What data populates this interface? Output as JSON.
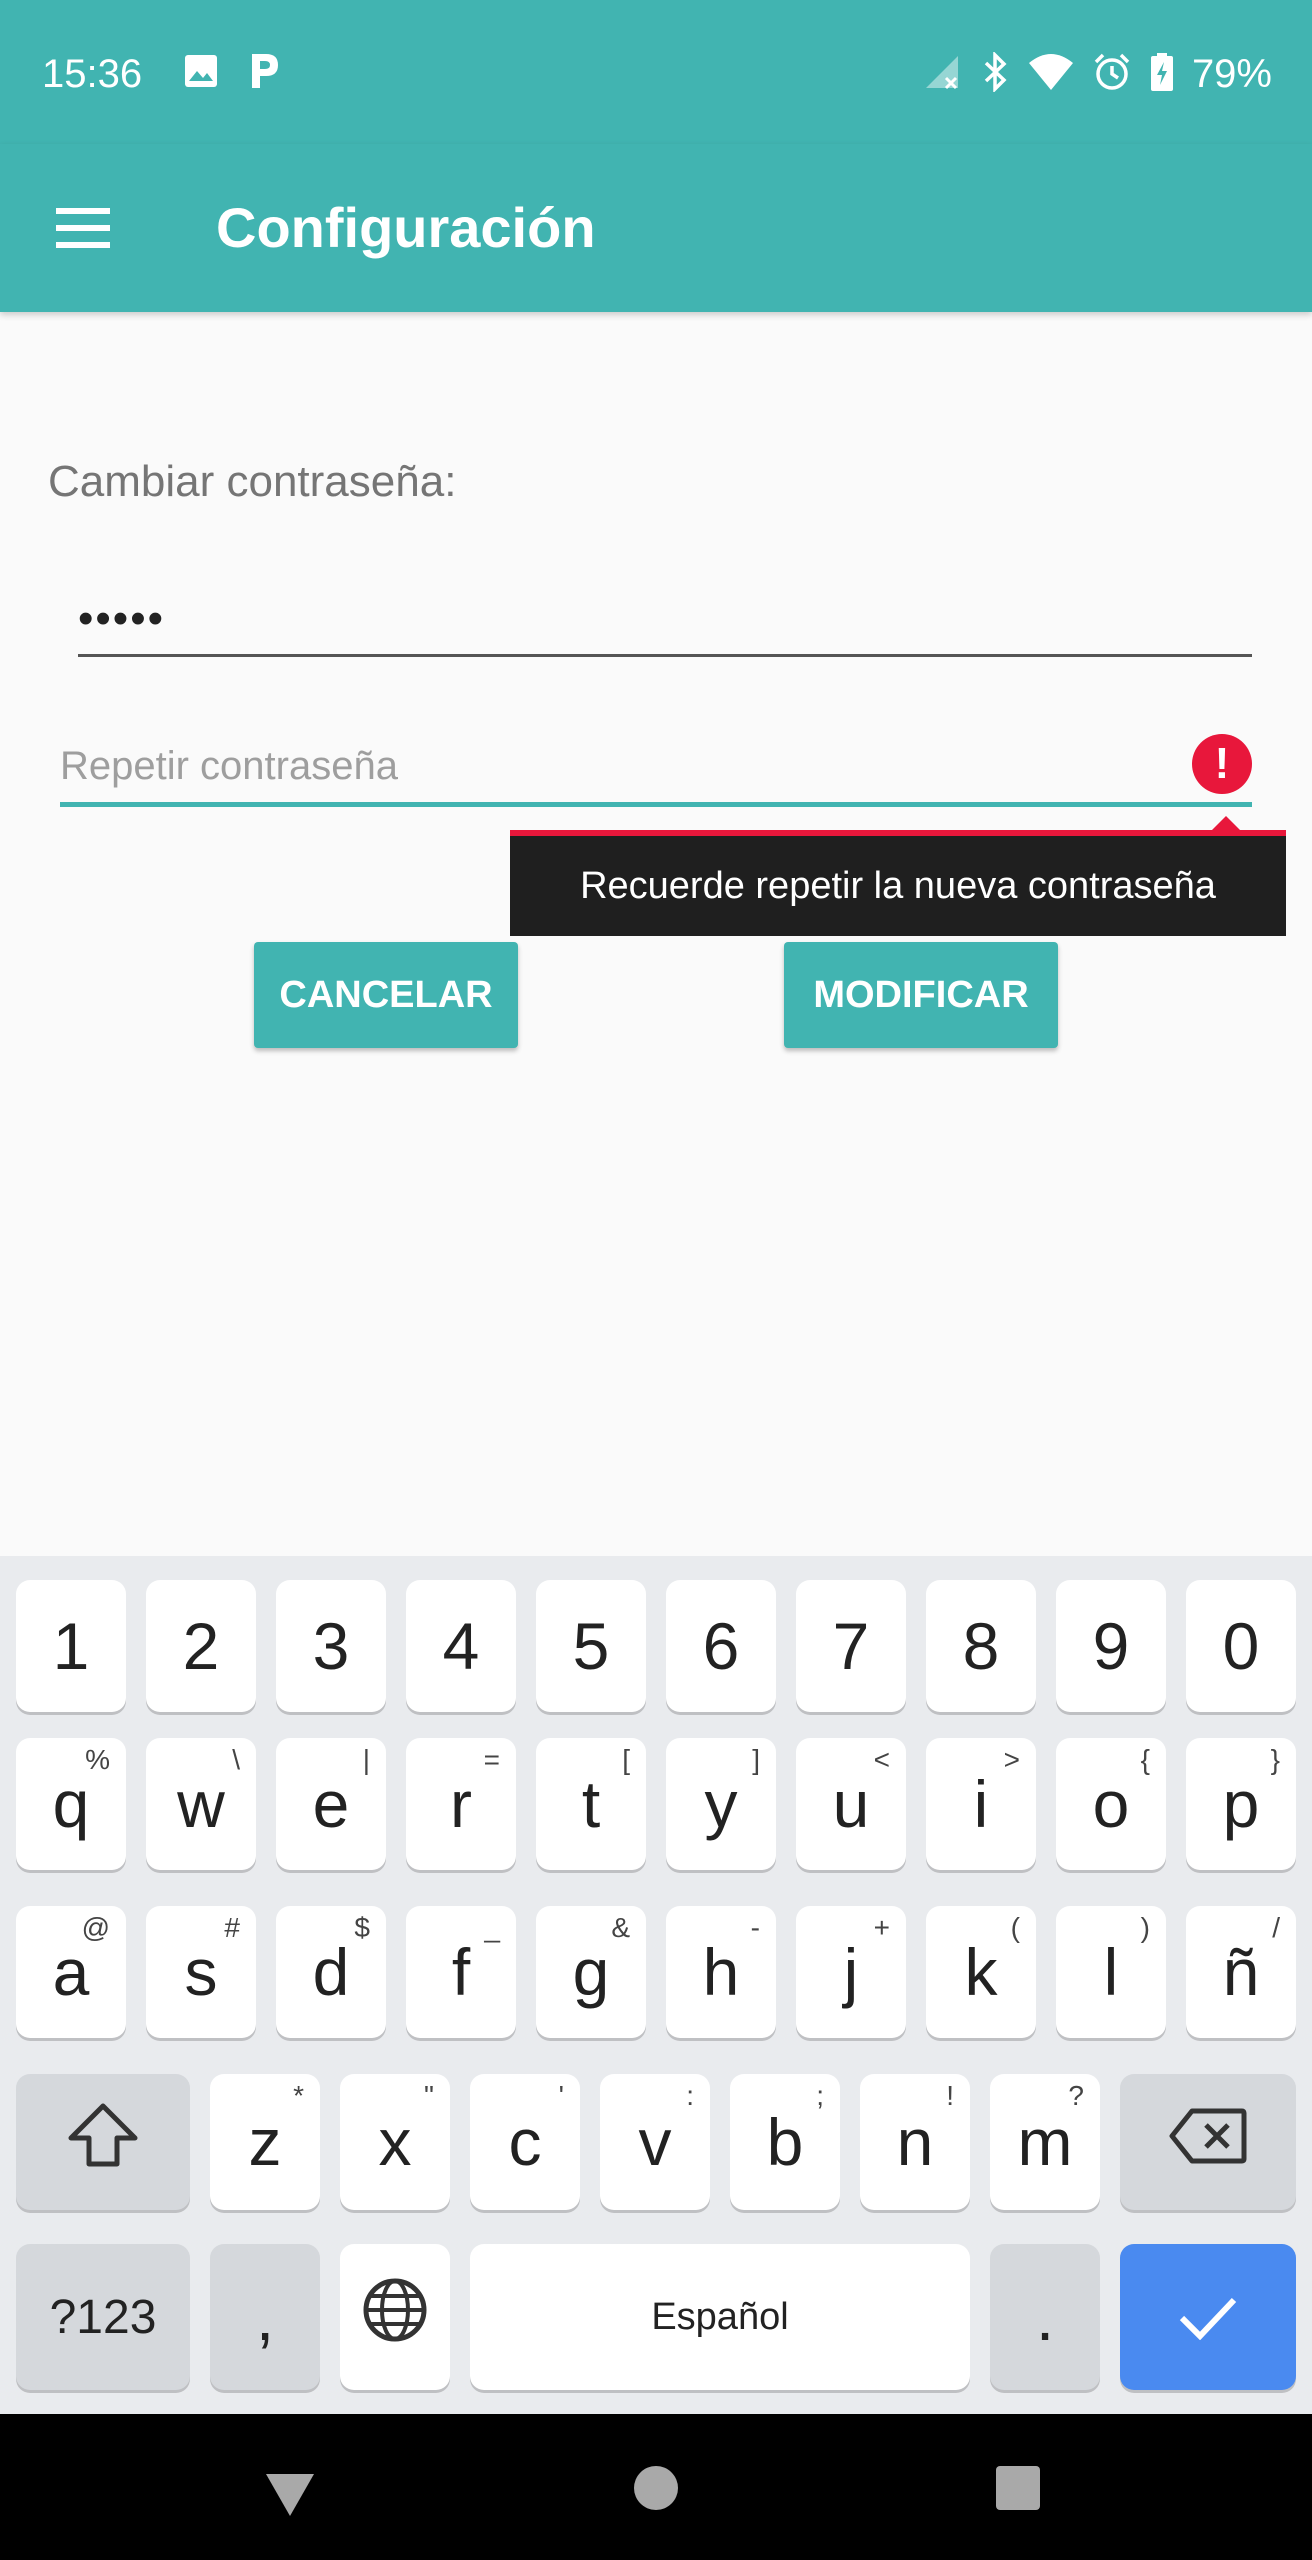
{
  "status_bar": {
    "time": "15:36",
    "left_icons": [
      "image-icon",
      "parking-app-icon"
    ],
    "right_icons": [
      "signal-off-icon",
      "bluetooth-icon",
      "wifi-icon",
      "alarm-icon",
      "battery-charging-icon"
    ],
    "battery": "79%"
  },
  "app_bar": {
    "menu_icon": "hamburger-menu-icon",
    "title": "Configuración",
    "color": "#41b4b1"
  },
  "form": {
    "section_label": "Cambiar contraseña:",
    "password_value": "•••••",
    "repeat_placeholder": "Repetir contraseña",
    "error_icon": "!",
    "error_message": "Recuerde repetir la nueva contraseña",
    "cancel_label": "CANCELAR",
    "modify_label": "MODIFICAR",
    "error_color": "#e8173b"
  },
  "keyboard": {
    "row_numbers": [
      {
        "key": "1"
      },
      {
        "key": "2"
      },
      {
        "key": "3"
      },
      {
        "key": "4"
      },
      {
        "key": "5"
      },
      {
        "key": "6"
      },
      {
        "key": "7"
      },
      {
        "key": "8"
      },
      {
        "key": "9"
      },
      {
        "key": "0"
      }
    ],
    "row1": [
      {
        "key": "q",
        "hint": "%"
      },
      {
        "key": "w",
        "hint": "\\"
      },
      {
        "key": "e",
        "hint": "|"
      },
      {
        "key": "r",
        "hint": "="
      },
      {
        "key": "t",
        "hint": "["
      },
      {
        "key": "y",
        "hint": "]"
      },
      {
        "key": "u",
        "hint": "<"
      },
      {
        "key": "i",
        "hint": ">"
      },
      {
        "key": "o",
        "hint": "{"
      },
      {
        "key": "p",
        "hint": "}"
      }
    ],
    "row2": [
      {
        "key": "a",
        "hint": "@"
      },
      {
        "key": "s",
        "hint": "#"
      },
      {
        "key": "d",
        "hint": "$"
      },
      {
        "key": "f",
        "hint": "_"
      },
      {
        "key": "g",
        "hint": "&"
      },
      {
        "key": "h",
        "hint": "-"
      },
      {
        "key": "j",
        "hint": "+"
      },
      {
        "key": "k",
        "hint": "("
      },
      {
        "key": "l",
        "hint": ")"
      },
      {
        "key": "ñ",
        "hint": "/"
      }
    ],
    "row3": [
      {
        "key": "z",
        "hint": "*"
      },
      {
        "key": "x",
        "hint": "\""
      },
      {
        "key": "c",
        "hint": "'"
      },
      {
        "key": "v",
        "hint": ":"
      },
      {
        "key": "b",
        "hint": ";"
      },
      {
        "key": "n",
        "hint": "!"
      },
      {
        "key": "m",
        "hint": "?"
      }
    ],
    "shift_icon": "shift-icon",
    "backspace_icon": "backspace-icon",
    "mode_label": "?123",
    "comma_label": ",",
    "globe_icon": "globe-icon",
    "space_label": "Español",
    "period_label": ".",
    "enter_icon": "checkmark-icon",
    "enter_color": "#4a8af0"
  },
  "nav_bar": {
    "icons": [
      "back-icon",
      "home-icon",
      "recents-icon"
    ]
  }
}
